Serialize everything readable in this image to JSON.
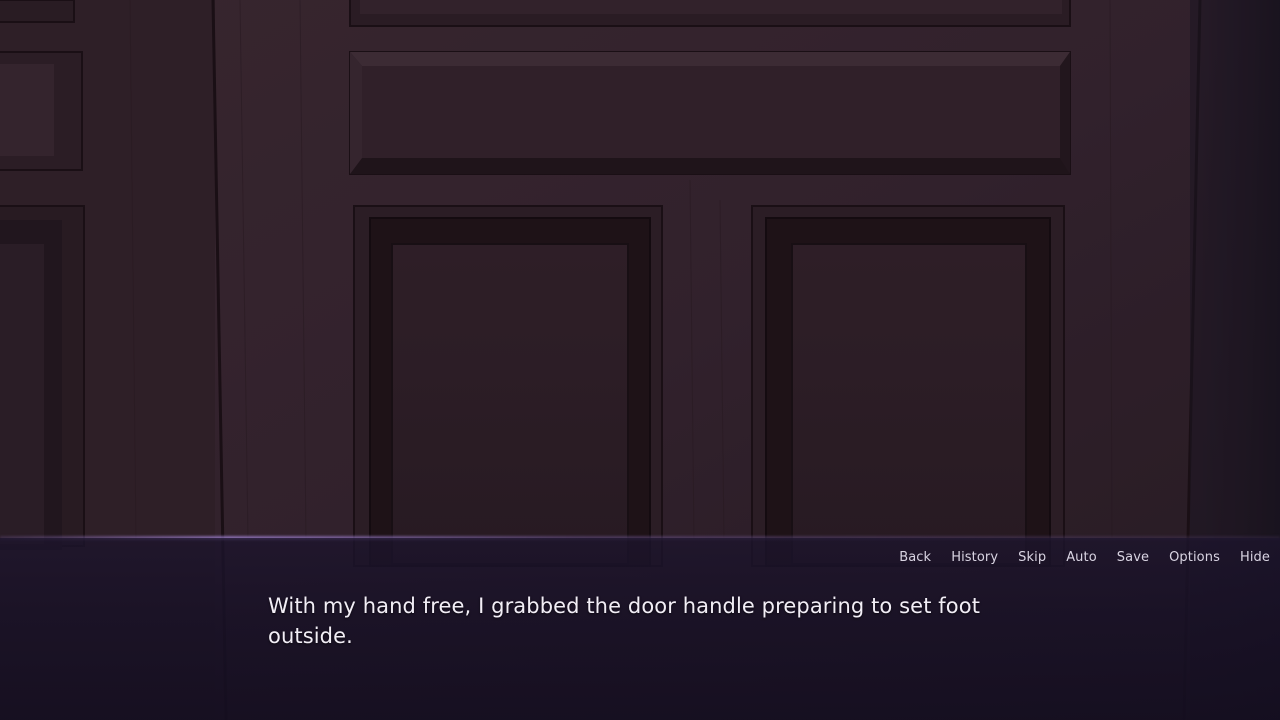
{
  "scene": {
    "background": "wooden-door-panels",
    "colors": {
      "wood_base": "#3a2830",
      "wood_dark": "#2c1d24",
      "panel_line": "#1c1116",
      "panel_inner": "#33232b",
      "shadow_right": "#1a1422"
    }
  },
  "quick_menu": {
    "items": [
      "Back",
      "History",
      "Skip",
      "Auto",
      "Save",
      "Options",
      "Hide"
    ]
  },
  "dialogue": {
    "text": "With my hand free, I grabbed the door handle preparing to set foot outside."
  },
  "colors": {
    "dialogue_bg": "#1c142c",
    "accent_glow": "#a082d2",
    "text": "#f2eef6",
    "menu_text": "#d9d4e2"
  }
}
